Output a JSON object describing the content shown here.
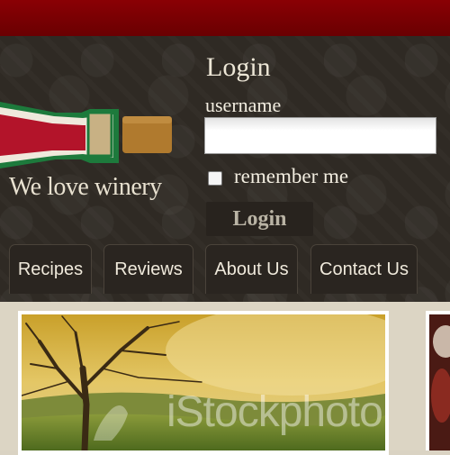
{
  "header": {
    "tagline": "We love winery"
  },
  "login": {
    "title": "Login",
    "username_label": "username",
    "username_value": "",
    "remember_label": "remember me",
    "remember_checked": false,
    "button_label": "Login"
  },
  "nav": {
    "items": [
      {
        "label": "Recipes"
      },
      {
        "label": "Reviews"
      },
      {
        "label": "About Us"
      },
      {
        "label": "Contact Us"
      }
    ]
  },
  "featured": {
    "watermark": "iStockphoto"
  },
  "colors": {
    "topbar": "#7a0003",
    "header_bg": "#2f2a24",
    "content_bg": "#dcd5c4",
    "wine_red": "#b3142a",
    "bottle_green": "#1f7a3a",
    "cork": "#b07a2e"
  },
  "icons": {
    "logo": "wine-bottle-icon",
    "checkbox": "checkbox-icon"
  }
}
